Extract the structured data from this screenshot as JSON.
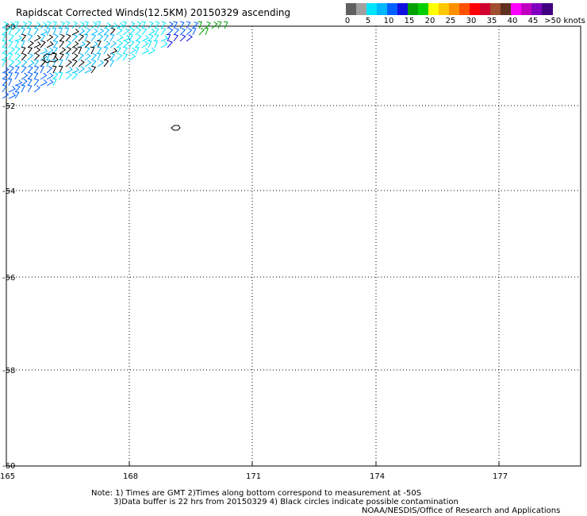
{
  "title": "Rapidscat Corrected Winds(12.5KM) 20150329 ascending",
  "legend": {
    "labels": [
      "0",
      "5",
      "10",
      "15",
      "20",
      "25",
      "30",
      "35",
      "40",
      "45",
      ">50 knots"
    ],
    "colors": [
      "#606060",
      "#a0a0a0",
      "#00e5ff",
      "#00b8ff",
      "#0060ff",
      "#1010e0",
      "#00a000",
      "#00d000",
      "#ffff00",
      "#ffc800",
      "#ff9000",
      "#ff5000",
      "#ff0000",
      "#d00030",
      "#a05030",
      "#603020",
      "#ff00ff",
      "#c000c0",
      "#8000c0",
      "#400080"
    ]
  },
  "lat_labels": [
    "-50",
    "-52",
    "-54",
    "-56",
    "-58",
    "-60"
  ],
  "lon_labels": [
    "165",
    "168",
    "171",
    "174",
    "177"
  ],
  "notes": {
    "line1": "Note: 1) Times are GMT 2)Times along bottom correspond to measurement at -50S",
    "line2": "3)Data buffer is 22 hrs from 20150329 4) Black circles indicate possible contamination",
    "line3": "NOAA/NESDIS/Office of Research and Applications"
  }
}
